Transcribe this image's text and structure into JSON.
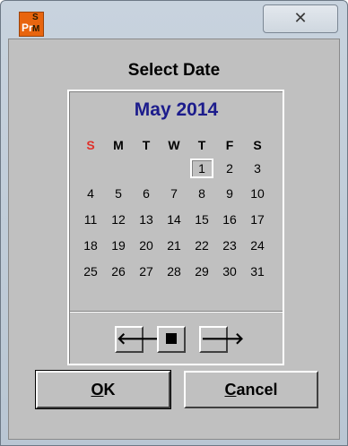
{
  "window": {
    "icon_letters": {
      "p": "Pr",
      "s": "S",
      "m": "M"
    },
    "close_glyph": "✕"
  },
  "dialog": {
    "title": "Select Date"
  },
  "calendar": {
    "month_label": "May 2014",
    "weekdays": [
      "S",
      "M",
      "T",
      "W",
      "T",
      "F",
      "S"
    ],
    "weeks": [
      [
        "",
        "",
        "",
        "",
        "1",
        "2",
        "3"
      ],
      [
        "4",
        "5",
        "6",
        "7",
        "8",
        "9",
        "10"
      ],
      [
        "11",
        "12",
        "13",
        "14",
        "15",
        "16",
        "17"
      ],
      [
        "18",
        "19",
        "20",
        "21",
        "22",
        "23",
        "24"
      ],
      [
        "25",
        "26",
        "27",
        "28",
        "29",
        "30",
        "31"
      ]
    ],
    "selected_day": "1",
    "nav": {
      "prev_glyph": "🡐",
      "next_glyph": "🡒"
    }
  },
  "buttons": {
    "ok": {
      "mnemonic": "O",
      "rest": "K"
    },
    "cancel": {
      "mnemonic": "C",
      "rest": "ancel"
    }
  },
  "colors": {
    "month_title": "#1c1c8c",
    "sunday_header": "#e0302a",
    "app_icon": "#e8650f"
  }
}
